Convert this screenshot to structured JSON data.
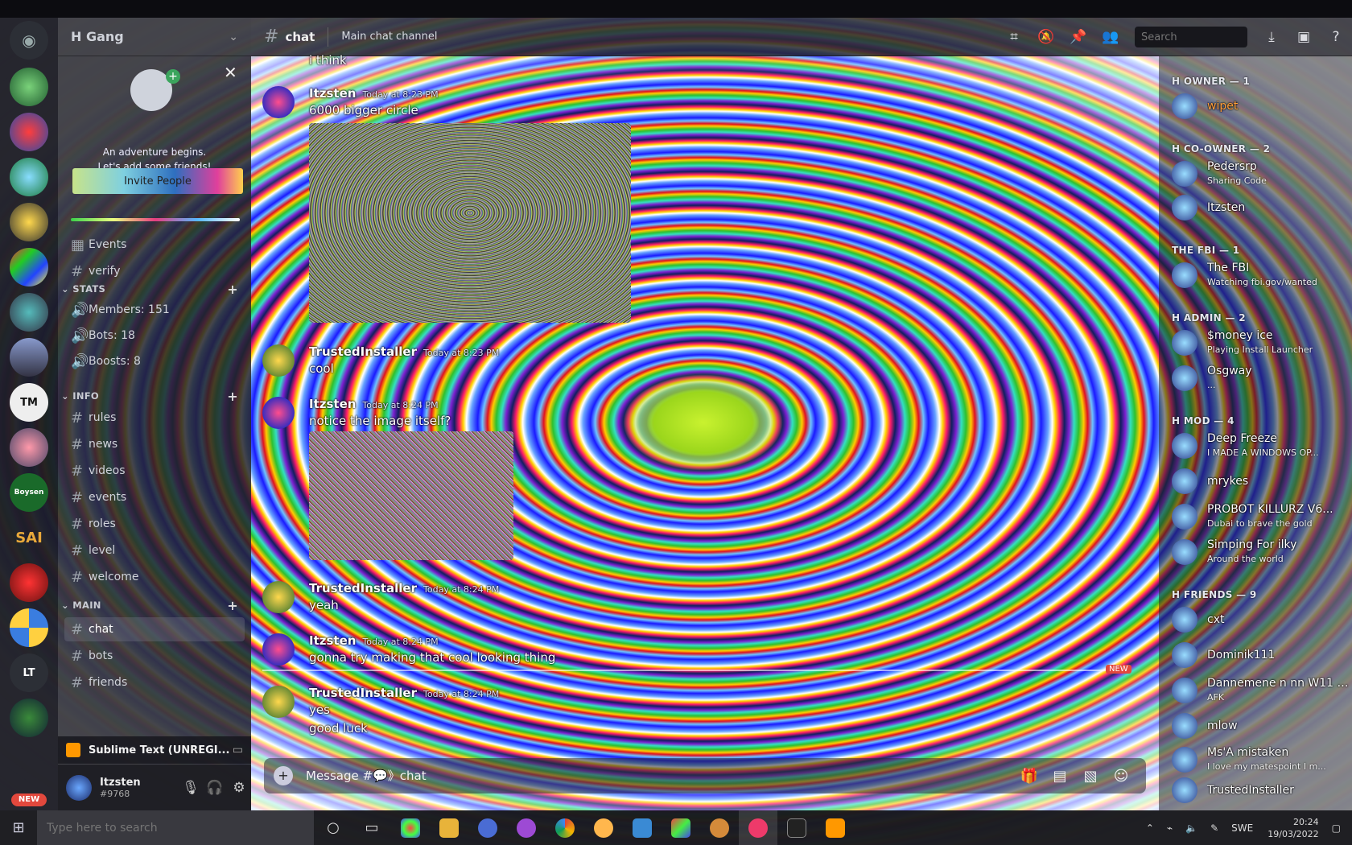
{
  "window": {
    "app": "Discord"
  },
  "guild": {
    "name": "H Gang"
  },
  "invite": {
    "line1": "An adventure begins.",
    "line2": "Let's add some friends!",
    "button": "Invite People"
  },
  "channels": {
    "events": "Events",
    "verify": "verify",
    "stats_category": "STATS",
    "stats": [
      "Members: 151",
      "Bots: 18",
      "Boosts: 8"
    ],
    "info_category": "INFO",
    "info": [
      "rules",
      "news",
      "videos",
      "events",
      "roles",
      "level",
      "welcome"
    ],
    "main_category": "MAIN",
    "main": [
      "chat",
      "bots",
      "friends"
    ]
  },
  "activity": {
    "label": "Sublime Text (UNREGI..."
  },
  "user": {
    "name": "Itzsten",
    "tag": "#9768"
  },
  "header": {
    "channel": "chat",
    "topic": "Main chat channel",
    "search_placeholder": "Search"
  },
  "messages": [
    {
      "author": "",
      "time": "",
      "text": "i think"
    },
    {
      "author": "Itzsten",
      "time": "Today at 8:23 PM",
      "text": "6000 bigger circle"
    },
    {
      "author": "TrustedInstaller",
      "time": "Today at 8:23 PM",
      "text": "cool"
    },
    {
      "author": "Itzsten",
      "time": "Today at 8:24 PM",
      "text": "notice the image itself?"
    },
    {
      "author": "TrustedInstaller",
      "time": "Today at 8:24 PM",
      "text": "yeah"
    },
    {
      "author": "Itzsten",
      "time": "Today at 8:24 PM",
      "text": "gonna try making that cool looking thing"
    },
    {
      "author": "TrustedInstaller",
      "time": "Today at 8:24 PM",
      "text": "yes",
      "text2": "good luck"
    }
  ],
  "new_marker": "NEW",
  "composer": {
    "placeholder": "Message #💬》chat"
  },
  "members": {
    "cats": [
      "H OWNER — 1",
      "H CO-OWNER — 2",
      "THE FBI — 1",
      "H ADMIN — 2",
      "H MOD — 4",
      "H FRIENDS — 9"
    ],
    "owner": [
      {
        "name": "wipet",
        "status": ""
      }
    ],
    "coowner": [
      {
        "name": "Pedersrp",
        "status": "Sharing Code"
      },
      {
        "name": "Itzsten",
        "status": ""
      }
    ],
    "fbi": [
      {
        "name": "The FBI",
        "status": "Watching fbi.gov/wanted"
      }
    ],
    "admin": [
      {
        "name": "$money ice",
        "status": "Playing Install Launcher"
      },
      {
        "name": "Osgway",
        "status": "..."
      }
    ],
    "mod": [
      {
        "name": "Deep Freeze",
        "status": "I MADE A WINDOWS OP..."
      },
      {
        "name": "mrykes",
        "status": ""
      },
      {
        "name": "PROBOT KILLURZ V6...",
        "status": "Dubai to brave the gold"
      },
      {
        "name": "Simping For ilky",
        "status": "Around the world"
      }
    ],
    "friends": [
      {
        "name": "cxt",
        "status": ""
      },
      {
        "name": "Dominik111",
        "status": ""
      },
      {
        "name": "Dannemene n nn W11 U...",
        "status": "AFK"
      },
      {
        "name": "mlow",
        "status": ""
      },
      {
        "name": "Ms'A mistaken",
        "status": "I love my matespoint I m..."
      },
      {
        "name": "TrustedInstaller",
        "status": ""
      }
    ]
  },
  "taskbar": {
    "search_placeholder": "Type here to search",
    "lang": "SWE",
    "time": "20:24",
    "date": "19/03/2022"
  },
  "servers": [
    "LT",
    "NEW"
  ],
  "colors": {
    "accent": "#5865f2",
    "owner": "#ff7a1a",
    "mention": "#e2483d"
  }
}
